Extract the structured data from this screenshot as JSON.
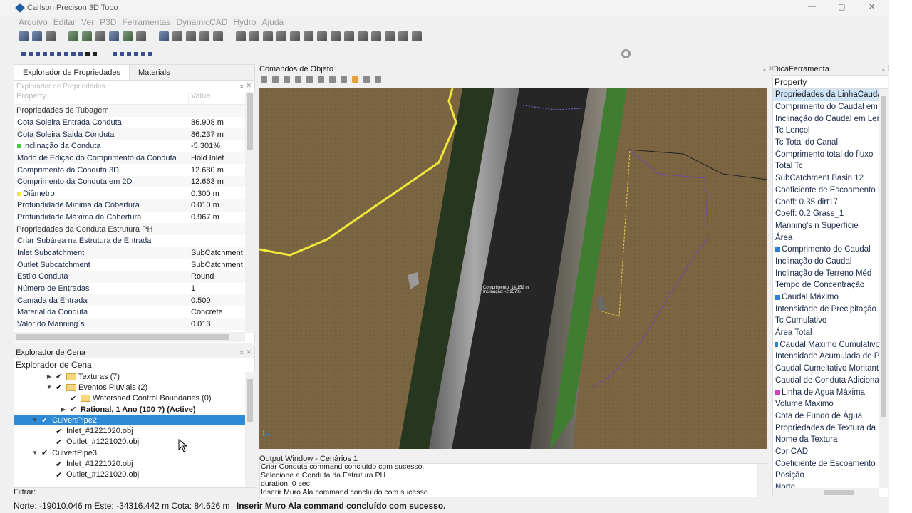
{
  "window": {
    "title": "Carlson Precison 3D Topo",
    "controls": [
      "—",
      "▢",
      "✕"
    ]
  },
  "menu": [
    "Arquivo",
    "Editar",
    "Ver",
    "P3D",
    "Ferramentas",
    "DynamicCAD",
    "Hydro",
    "Ajuda"
  ],
  "left_tabs": [
    "Explorador de Propriedades",
    "Materials"
  ],
  "property_explorer": {
    "subtitle": "Explorador de Propriedades",
    "col_property": "Property",
    "col_value": "Value",
    "rows": [
      {
        "k": "Propriedades de Tubagem",
        "v": "",
        "section": true
      },
      {
        "k": "Cota Soleira Entrada Conduta",
        "v": "86.908 m"
      },
      {
        "k": "Cota Soleira Saida Conduta",
        "v": "86.237 m"
      },
      {
        "k": "Inclinação da Conduta",
        "v": "-5.301%",
        "swatch": "#3fcf3f"
      },
      {
        "k": "Modo de Edição do Comprimento da Conduta",
        "v": "Hold Inlet"
      },
      {
        "k": "Comprimento da Conduta 3D",
        "v": "12.680 m"
      },
      {
        "k": "Comprimento da Conduta em 2D",
        "v": "12.663 m"
      },
      {
        "k": "Diâmetro",
        "v": "0.300 m",
        "swatch": "#f2e83a"
      },
      {
        "k": "Profundidade Mínima da Cobertura",
        "v": "0.010 m"
      },
      {
        "k": "Profundidade Máxima da Cobertura",
        "v": "0.967 m"
      },
      {
        "k": "Propriedades da Conduta Estrutura PH",
        "v": "",
        "section": true
      },
      {
        "k": "Criar Subárea na Estrutura de Entrada",
        "v": ""
      },
      {
        "k": "Inlet Subcatchment",
        "v": "SubCatchment"
      },
      {
        "k": "Outlet Subcatchment",
        "v": "SubCatchment"
      },
      {
        "k": "Estilo Conduta",
        "v": "Round"
      },
      {
        "k": "Número de Entradas",
        "v": "1"
      },
      {
        "k": "Camada da Entrada",
        "v": "0.500"
      },
      {
        "k": "Material da Conduta",
        "v": "Concrete"
      },
      {
        "k": "Valor do Manning´s",
        "v": "0.013"
      }
    ]
  },
  "scene_explorer": {
    "title": "Explorador de Cena",
    "subtitle": "Explorador de Cena",
    "items": [
      {
        "label": "Texturas (7)",
        "indent": 44,
        "exp": "▶",
        "folder": true
      },
      {
        "label": "Eventos Pluviais (2)",
        "indent": 44,
        "exp": "▼",
        "folder": true
      },
      {
        "label": "Watershed Control Boundaries (0)",
        "indent": 64,
        "exp": "",
        "folder": true
      },
      {
        "label": "Rational, 1 Ano (100 ?) (Active)",
        "indent": 64,
        "exp": "▶",
        "folder": false,
        "bold": true
      },
      {
        "label": "CulvertPipe2",
        "indent": 24,
        "exp": "▼",
        "folder": false,
        "selected": true
      },
      {
        "label": "Inlet_#1221020.obj",
        "indent": 44,
        "exp": "",
        "folder": false
      },
      {
        "label": "Outlet_#1221020.obj",
        "indent": 44,
        "exp": "",
        "folder": false
      },
      {
        "label": "CulvertPipe3",
        "indent": 24,
        "exp": "▼",
        "folder": false
      },
      {
        "label": "Inlet_#1221020.obj",
        "indent": 44,
        "exp": "",
        "folder": false
      },
      {
        "label": "Outlet_#1221020.obj",
        "indent": 44,
        "exp": "",
        "folder": false
      }
    ],
    "filter_label": "Filtrar:"
  },
  "viewport": {
    "title": "Comandos de Objeto",
    "annotation_line1": "Comprimento: 14.152 m",
    "annotation_line2": "Inclinação: -2.957%"
  },
  "output": {
    "title": "Output Window - Cenários 1",
    "lines": [
      "Criar Conduta command concluído com sucesso.",
      "Selecione a Conduta da Estrutura PH",
      "duration: 0 sec",
      "Inserir Muro Ala command concluído com sucesso."
    ]
  },
  "tooltip_panel": {
    "title": "DicaFerramenta",
    "header": "Property",
    "rows": [
      {
        "t": "Propriedades da LinhaCaudal",
        "sel": true
      },
      {
        "t": "Comprimento do Caudal em"
      },
      {
        "t": "Inclinação do Caudal em Len"
      },
      {
        "t": "Tc Lençol"
      },
      {
        "t": "Tc Total do Canal"
      },
      {
        "t": "Comprimento total do fluxo"
      },
      {
        "t": "Total Tc"
      },
      {
        "t": "SubCatchment Basin 12"
      },
      {
        "t": "Coeficiente de Escoamento I"
      },
      {
        "t": "Coeff: 0.35 dirt17"
      },
      {
        "t": "Coeff: 0.2 Grass_1"
      },
      {
        "t": "Manning's n Superfície"
      },
      {
        "t": "Área"
      },
      {
        "t": "Comprimento do Caudal",
        "swatch": "#2a7fd4"
      },
      {
        "t": "Inclinação do Caudal"
      },
      {
        "t": "Inclinação de Terreno Méd"
      },
      {
        "t": "Tempo de Concentração"
      },
      {
        "t": "Caudal Máximo",
        "swatch": "#2a7fd4"
      },
      {
        "t": "Intensidade de Precipitação"
      },
      {
        "t": "Tc Cumulativo"
      },
      {
        "t": "Área Total"
      },
      {
        "t": "Caudal Máximo Cumulativo",
        "swatch": "#2a7fd4"
      },
      {
        "t": "Intensidade Acumulada de Pr"
      },
      {
        "t": "Caudal Cumeltativo Montant"
      },
      {
        "t": "Caudal de Conduta Adicional"
      },
      {
        "t": "Linha de Agua Máxima",
        "swatch": "#d43fc8"
      },
      {
        "t": "Volume Maximo"
      },
      {
        "t": "Cota de Fundo de Água"
      },
      {
        "t": "Propriedades de Textura da S"
      },
      {
        "t": "Nome da Textura"
      },
      {
        "t": "Cor CAD"
      },
      {
        "t": "Coeficiente de Escoamento"
      },
      {
        "t": "Posição"
      },
      {
        "t": "Norte"
      }
    ]
  },
  "status": {
    "coords": "Norte: -19010.046 m Este: -34316.442 m Cota: 84.626 m",
    "message": "Inserir Muro Ala command concluído com sucesso."
  },
  "colors": {
    "selection": "#2f8ad6",
    "accent": "#1f5fa8"
  }
}
